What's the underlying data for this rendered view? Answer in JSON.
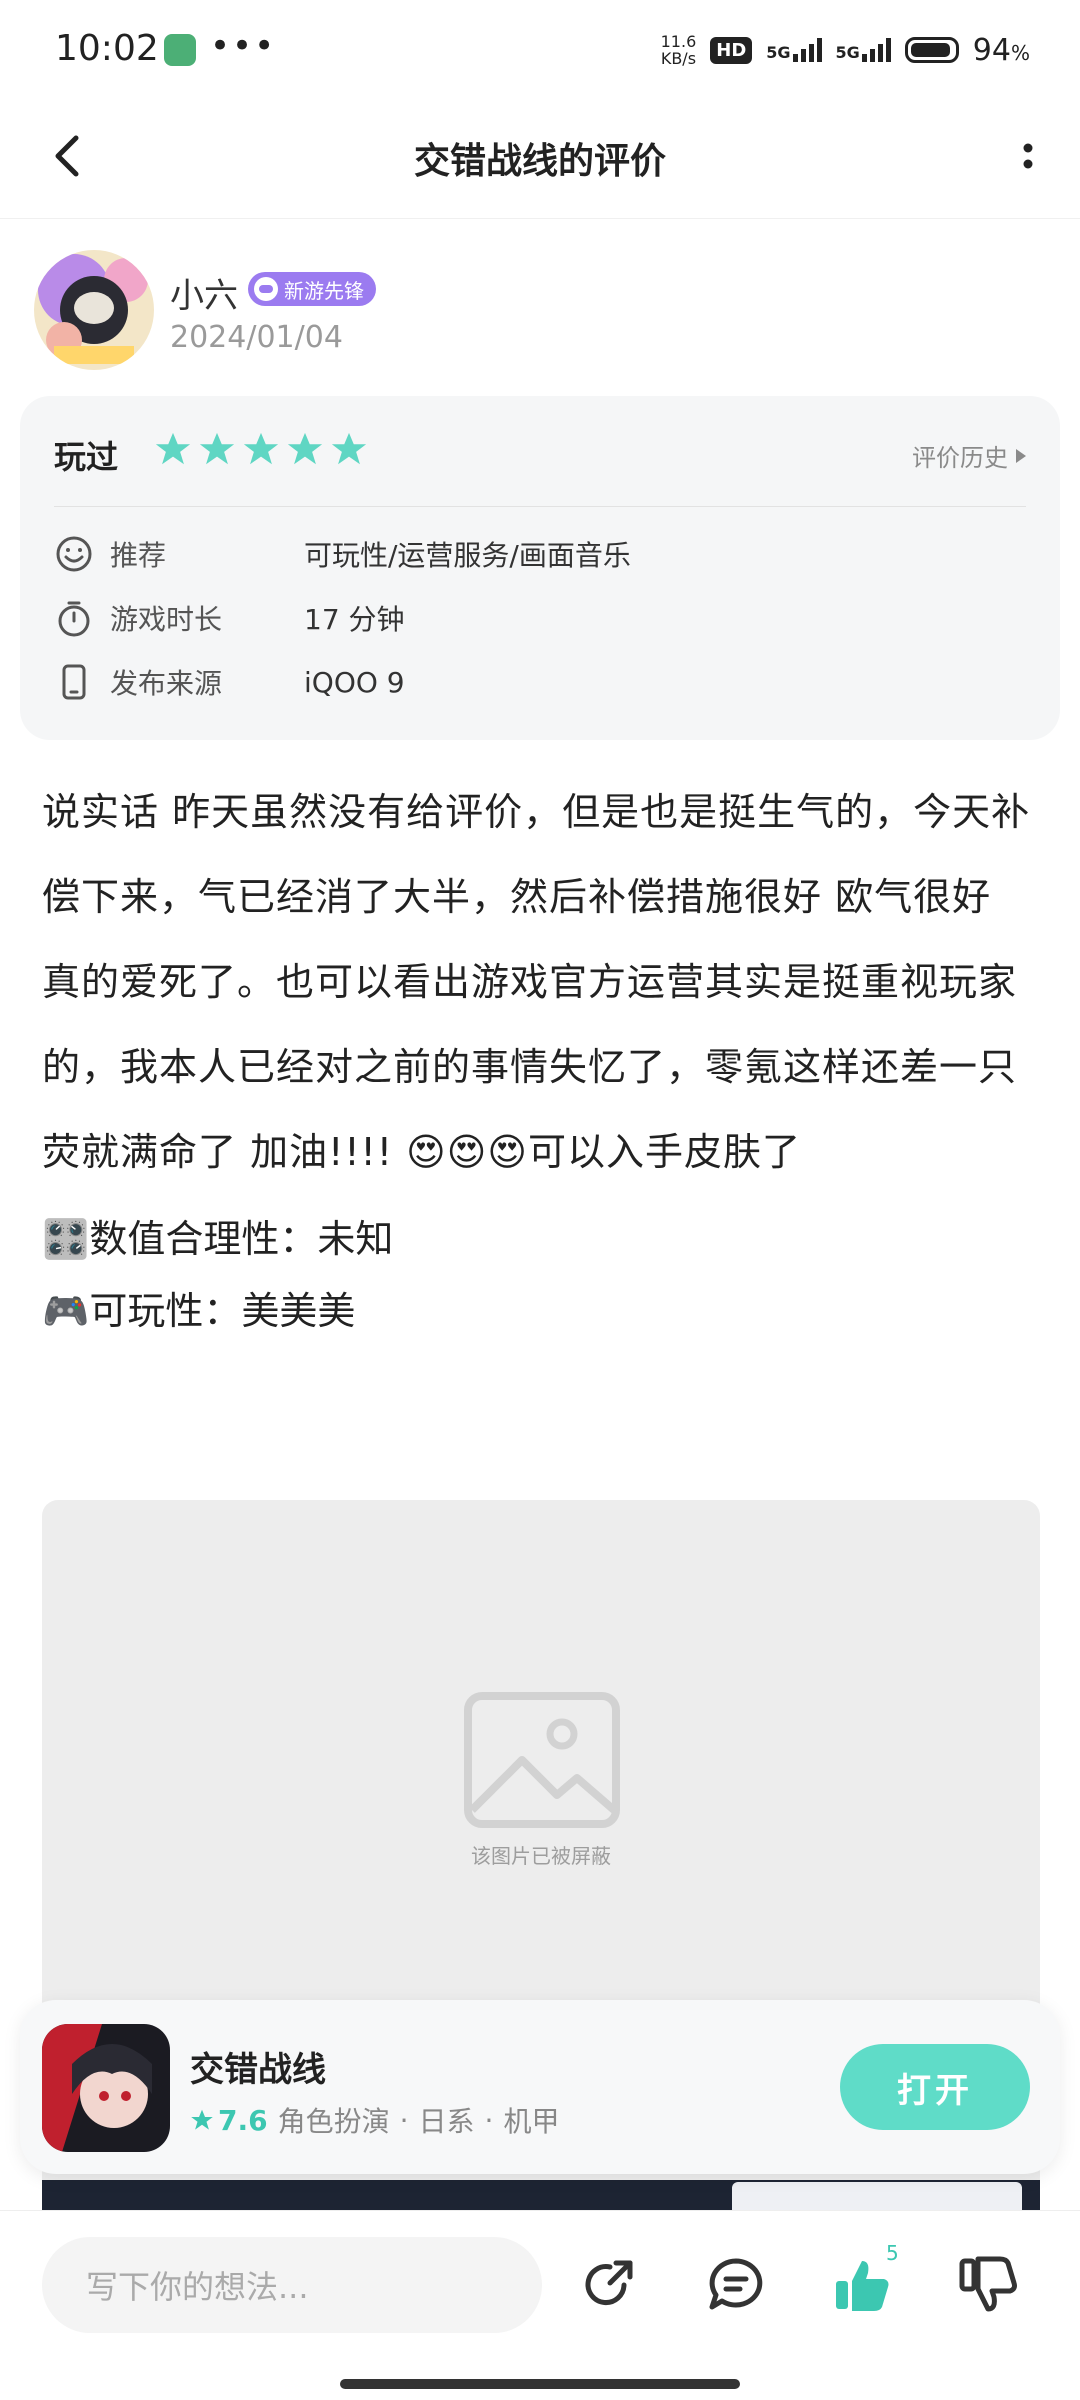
{
  "status_bar": {
    "time": "10:02",
    "dots": "•••",
    "net_speed": "11.6",
    "net_unit": "KB/s",
    "hd": "HD",
    "sig1": "5G",
    "sig2": "5G",
    "battery_value": "94",
    "battery_unit": "%"
  },
  "header": {
    "title": "交错战线的评价"
  },
  "author": {
    "name": "小六",
    "badge": "新游先锋",
    "date": "2024/01/04"
  },
  "review_info": {
    "status": "玩过",
    "stars": 5,
    "history_label": "评价历史",
    "rows": [
      {
        "label": "推荐",
        "value": "可玩性/运营服务/画面音乐"
      },
      {
        "label": "游戏时长",
        "value": "17 分钟"
      },
      {
        "label": "发布来源",
        "value": "iQOO 9"
      }
    ]
  },
  "content": {
    "paragraph_a": "说实话 昨天虽然没有给评价，但是也是挺生气的，今天补偿下来，气已经消了大半，然后补偿措施很好 欧气很好 真的爱死了。也可以看出游戏官方运营其实是挺重视玩家的，我本人已经对之前的事情失忆了，零氪这样还差一只荧就满命了 加油!!!! ",
    "emojis": "😍😍😍",
    "paragraph_b": "可以入手皮肤了",
    "line_numeric_emoji": "🎛️",
    "line_numeric": "数值合理性：未知",
    "line_play_emoji": "🎮",
    "line_play": "可玩性：美美美",
    "blocked_image_text": "该图片已被屏蔽"
  },
  "game_card": {
    "name": "交错战线",
    "rating": "7.6",
    "tags": [
      "角色扮演",
      "日系",
      "机甲"
    ],
    "separator": "·",
    "open_label": "打开"
  },
  "bottom_bar": {
    "input_placeholder": "写下你的想法...",
    "like_count": "5"
  },
  "colors": {
    "accent": "#3cc7b1",
    "button": "#5fdcc8",
    "badge": "#9b7bf0"
  }
}
